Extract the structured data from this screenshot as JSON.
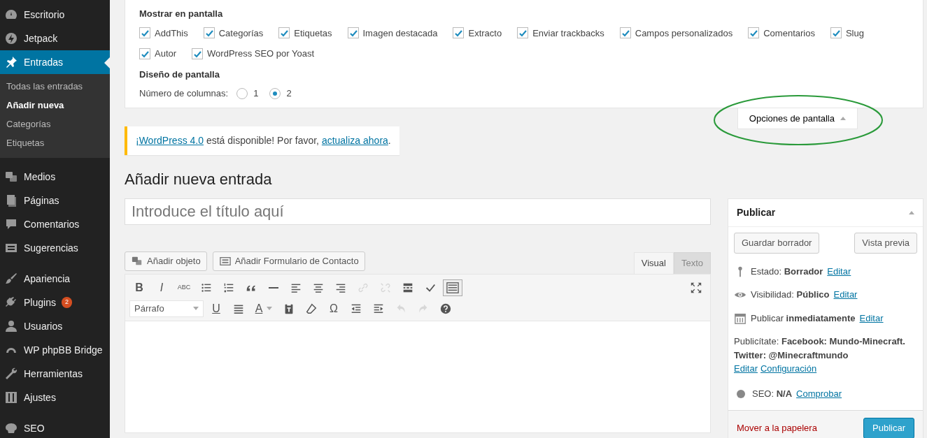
{
  "sidebar": {
    "items": [
      {
        "label": "Escritorio",
        "selected": false
      },
      {
        "label": "Jetpack",
        "selected": false
      },
      {
        "label": "Entradas",
        "selected": true,
        "children": [
          {
            "label": "Todas las entradas",
            "selected": false
          },
          {
            "label": "Añadir nueva",
            "selected": true
          },
          {
            "label": "Categorías",
            "selected": false
          },
          {
            "label": "Etiquetas",
            "selected": false
          }
        ]
      },
      {
        "label": "Medios",
        "selected": false
      },
      {
        "label": "Páginas",
        "selected": false
      },
      {
        "label": "Comentarios",
        "selected": false
      },
      {
        "label": "Sugerencias",
        "selected": false
      },
      {
        "label": "Apariencia",
        "selected": false
      },
      {
        "label": "Plugins",
        "selected": false,
        "badge": "2"
      },
      {
        "label": "Usuarios",
        "selected": false
      },
      {
        "label": "WP phpBB Bridge",
        "selected": false
      },
      {
        "label": "Herramientas",
        "selected": false
      },
      {
        "label": "Ajustes",
        "selected": false
      },
      {
        "label": "SEO",
        "selected": false
      }
    ]
  },
  "screen_options": {
    "show_title": "Mostrar en pantalla",
    "checkboxes": [
      {
        "label": "AddThis",
        "checked": true
      },
      {
        "label": "Categorías",
        "checked": true
      },
      {
        "label": "Etiquetas",
        "checked": true
      },
      {
        "label": "Imagen destacada",
        "checked": true
      },
      {
        "label": "Extracto",
        "checked": true
      },
      {
        "label": "Enviar trackbacks",
        "checked": true
      },
      {
        "label": "Campos personalizados",
        "checked": true
      },
      {
        "label": "Comentarios",
        "checked": true
      },
      {
        "label": "Slug",
        "checked": true
      },
      {
        "label": "Autor",
        "checked": true
      },
      {
        "label": "WordPress SEO por Yoast",
        "checked": true
      }
    ],
    "layout_title": "Diseño de pantalla",
    "columns_label": "Número de columnas:",
    "columns": [
      {
        "label": "1",
        "selected": false
      },
      {
        "label": "2",
        "selected": true
      }
    ],
    "tab_label": "Opciones de pantalla"
  },
  "notice": {
    "link_1": "¡WordPress 4.0",
    "text_1": " está disponible! Por favor, ",
    "link_2": "actualiza ahora",
    "text_2": "."
  },
  "heading": "Añadir nueva entrada",
  "title_field": {
    "placeholder": "Introduce el título aquí"
  },
  "media_buttons": [
    "Añadir objeto",
    "Añadir Formulario de Contacto"
  ],
  "editor_tabs": [
    {
      "label": "Visual",
      "selected": true
    },
    {
      "label": "Texto",
      "selected": false
    }
  ],
  "toolbar": {
    "row_1": [
      {
        "kind": "letter",
        "text": "B",
        "disabled": false,
        "on": false
      },
      {
        "kind": "letter",
        "text": "I",
        "disabled": false,
        "on": false
      },
      {
        "kind": "letter",
        "text": "ABC",
        "disabled": false,
        "on": false
      },
      {
        "kind": "icon",
        "disabled": false,
        "on": false
      },
      {
        "kind": "icon",
        "disabled": false,
        "on": false
      },
      {
        "kind": "icon",
        "disabled": false,
        "on": false
      },
      {
        "kind": "icon",
        "disabled": false,
        "on": false
      },
      {
        "kind": "icon",
        "disabled": false,
        "on": false
      },
      {
        "kind": "icon",
        "disabled": false,
        "on": false
      },
      {
        "kind": "icon",
        "disabled": false,
        "on": false
      },
      {
        "kind": "icon",
        "disabled": true,
        "on": false
      },
      {
        "kind": "icon",
        "disabled": true,
        "on": false
      },
      {
        "kind": "icon",
        "disabled": false,
        "on": false
      },
      {
        "kind": "icon",
        "disabled": false,
        "on": false
      },
      {
        "kind": "icon",
        "disabled": false,
        "on": true
      }
    ],
    "format_select": "Párrafo",
    "row_2": [
      {
        "kind": "letter",
        "text": "U",
        "disabled": false
      },
      {
        "kind": "icon",
        "disabled": false
      },
      {
        "kind": "letter",
        "text": "A",
        "disabled": false
      },
      {
        "kind": "icon",
        "disabled": false
      },
      {
        "kind": "icon",
        "disabled": false
      },
      {
        "kind": "letter",
        "text": "Ω",
        "disabled": false
      },
      {
        "kind": "icon",
        "disabled": false
      },
      {
        "kind": "icon",
        "disabled": false
      },
      {
        "kind": "icon",
        "disabled": true
      },
      {
        "kind": "icon",
        "disabled": true
      },
      {
        "kind": "icon",
        "disabled": false
      }
    ]
  },
  "publish_box": {
    "title": "Publicar",
    "save_draft": "Guardar borrador",
    "preview": "Vista previa",
    "rows": [
      {
        "kind": "status",
        "text": "Estado: **Borrador**",
        "link": "Editar"
      },
      {
        "kind": "visibility",
        "text": "Visibilidad: **Público**",
        "link": "Editar"
      },
      {
        "kind": "schedule",
        "text": "Publicar **inmediatamente**",
        "link": "Editar"
      }
    ],
    "share_text": "Publicítate: **Facebook: Mundo-Minecraft. Twitter: @Minecraftmundo**",
    "share_links": [
      "Editar",
      "Configuración"
    ],
    "seo": {
      "text": "SEO: **N/A**",
      "link": "Comprobar",
      "color": "#888888"
    },
    "trash": "Mover a la papelera",
    "publish": "Publicar"
  }
}
